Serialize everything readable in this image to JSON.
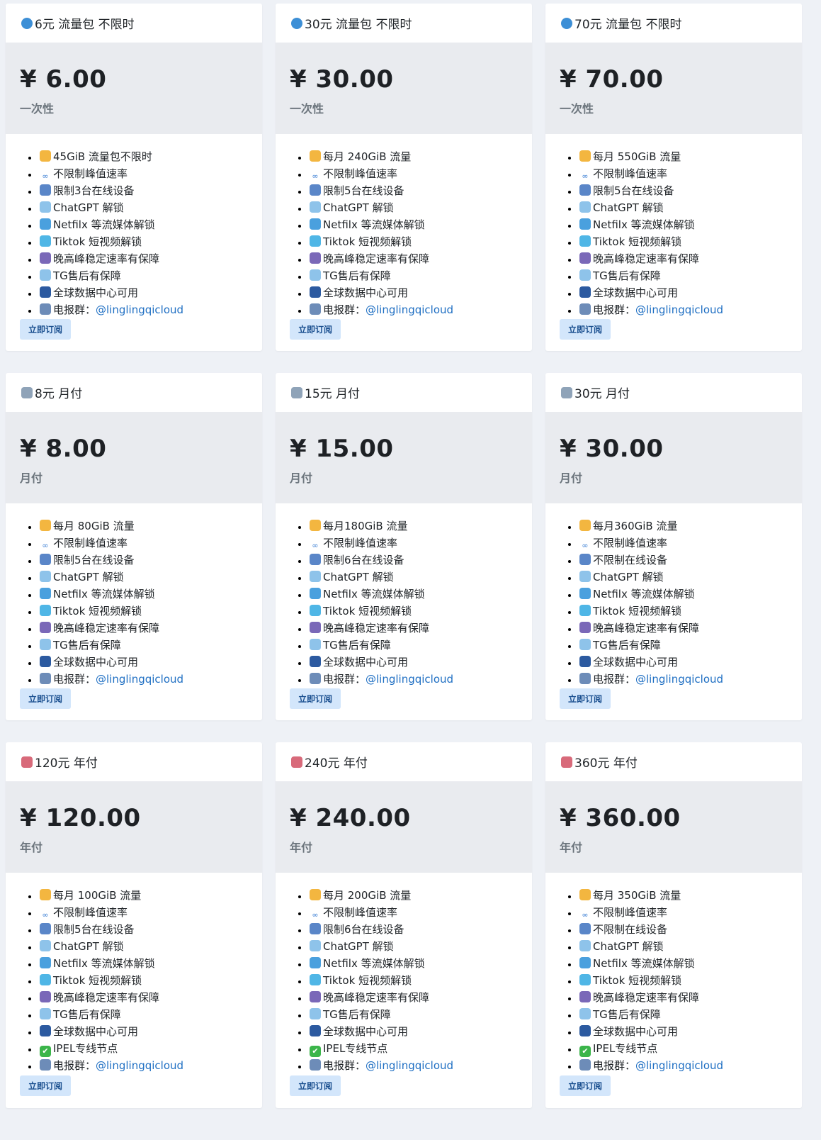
{
  "plans": [
    {
      "icon": "globe-icon",
      "name": "6元 流量包 不限时",
      "price": "¥ 6.00",
      "period": "一次性",
      "features": [
        {
          "icon": "person-icon",
          "text": "45GiB 流量包不限时"
        },
        {
          "icon": "infinity-icon",
          "text": "不限制峰值速率"
        },
        {
          "icon": "chart-icon",
          "text": "限制3台在线设备"
        },
        {
          "icon": "robot-icon",
          "text": "ChatGPT 解锁"
        },
        {
          "icon": "fish-icon",
          "text": "Netfilx 等流媒体解锁"
        },
        {
          "icon": "dolphin-icon",
          "text": "Tiktok 短视频解锁"
        },
        {
          "icon": "planet-icon",
          "text": "晚高峰稳定速率有保障"
        },
        {
          "icon": "robot-icon",
          "text": "TG售后有保障"
        },
        {
          "icon": "satellite-icon",
          "text": "全球数据中心可用"
        },
        {
          "icon": "speech-icon",
          "text": "电报群：",
          "link": "@linglingqicloud"
        }
      ],
      "button": "立即订阅"
    },
    {
      "icon": "globe-icon",
      "name": "30元 流量包 不限时",
      "price": "¥ 30.00",
      "period": "一次性",
      "features": [
        {
          "icon": "person-icon",
          "text": "每月 240GiB 流量"
        },
        {
          "icon": "infinity-icon",
          "text": "不限制峰值速率"
        },
        {
          "icon": "chart-icon",
          "text": "限制5台在线设备"
        },
        {
          "icon": "robot-icon",
          "text": "ChatGPT 解锁"
        },
        {
          "icon": "fish-icon",
          "text": "Netfilx 等流媒体解锁"
        },
        {
          "icon": "dolphin-icon",
          "text": "Tiktok 短视频解锁"
        },
        {
          "icon": "planet-icon",
          "text": "晚高峰稳定速率有保障"
        },
        {
          "icon": "robot-icon",
          "text": "TG售后有保障"
        },
        {
          "icon": "satellite-icon",
          "text": "全球数据中心可用"
        },
        {
          "icon": "speech-icon",
          "text": "电报群：",
          "link": "@linglingqicloud"
        }
      ],
      "button": "立即订阅"
    },
    {
      "icon": "globe-icon",
      "name": "70元 流量包 不限时",
      "price": "¥ 70.00",
      "period": "一次性",
      "features": [
        {
          "icon": "person-icon",
          "text": "每月 550GiB 流量"
        },
        {
          "icon": "infinity-icon",
          "text": "不限制峰值速率"
        },
        {
          "icon": "chart-icon",
          "text": "限制5台在线设备"
        },
        {
          "icon": "robot-icon",
          "text": "ChatGPT 解锁"
        },
        {
          "icon": "fish-icon",
          "text": "Netfilx 等流媒体解锁"
        },
        {
          "icon": "dolphin-icon",
          "text": "Tiktok 短视频解锁"
        },
        {
          "icon": "planet-icon",
          "text": "晚高峰稳定速率有保障"
        },
        {
          "icon": "robot-icon",
          "text": "TG售后有保障"
        },
        {
          "icon": "satellite-icon",
          "text": "全球数据中心可用"
        },
        {
          "icon": "speech-icon",
          "text": "电报群：",
          "link": "@linglingqicloud"
        }
      ],
      "button": "立即订阅"
    },
    {
      "icon": "plane-icon",
      "name": "8元 月付",
      "price": "¥ 8.00",
      "period": "月付",
      "features": [
        {
          "icon": "person-icon",
          "text": "每月 80GiB 流量"
        },
        {
          "icon": "infinity-icon",
          "text": "不限制峰值速率"
        },
        {
          "icon": "chart-icon",
          "text": "限制5台在线设备"
        },
        {
          "icon": "robot-icon",
          "text": "ChatGPT 解锁"
        },
        {
          "icon": "fish-icon",
          "text": "Netfilx 等流媒体解锁"
        },
        {
          "icon": "dolphin-icon",
          "text": "Tiktok 短视频解锁"
        },
        {
          "icon": "planet-icon",
          "text": "晚高峰稳定速率有保障"
        },
        {
          "icon": "robot-icon",
          "text": "TG售后有保障"
        },
        {
          "icon": "satellite-icon",
          "text": "全球数据中心可用"
        },
        {
          "icon": "speech-icon",
          "text": "电报群：",
          "link": "@linglingqicloud"
        }
      ],
      "button": "立即订阅"
    },
    {
      "icon": "plane-icon",
      "name": "15元 月付",
      "price": "¥ 15.00",
      "period": "月付",
      "features": [
        {
          "icon": "person-icon",
          "text": "每月180GiB 流量"
        },
        {
          "icon": "infinity-icon",
          "text": "不限制峰值速率"
        },
        {
          "icon": "chart-icon",
          "text": "限制6台在线设备"
        },
        {
          "icon": "robot-icon",
          "text": "ChatGPT 解锁"
        },
        {
          "icon": "fish-icon",
          "text": "Netfilx 等流媒体解锁"
        },
        {
          "icon": "dolphin-icon",
          "text": "Tiktok 短视频解锁"
        },
        {
          "icon": "planet-icon",
          "text": "晚高峰稳定速率有保障"
        },
        {
          "icon": "robot-icon",
          "text": "TG售后有保障"
        },
        {
          "icon": "satellite-icon",
          "text": "全球数据中心可用"
        },
        {
          "icon": "speech-icon",
          "text": "电报群：",
          "link": "@linglingqicloud"
        }
      ],
      "button": "立即订阅"
    },
    {
      "icon": "plane-icon",
      "name": "30元 月付",
      "price": "¥ 30.00",
      "period": "月付",
      "features": [
        {
          "icon": "person-icon",
          "text": "每月360GiB 流量"
        },
        {
          "icon": "infinity-icon",
          "text": "不限制峰值速率"
        },
        {
          "icon": "chart-icon",
          "text": "不限制在线设备"
        },
        {
          "icon": "robot-icon",
          "text": "ChatGPT 解锁"
        },
        {
          "icon": "fish-icon",
          "text": "Netfilx 等流媒体解锁"
        },
        {
          "icon": "dolphin-icon",
          "text": "Tiktok 短视频解锁"
        },
        {
          "icon": "planet-icon",
          "text": "晚高峰稳定速率有保障"
        },
        {
          "icon": "robot-icon",
          "text": "TG售后有保障"
        },
        {
          "icon": "satellite-icon",
          "text": "全球数据中心可用"
        },
        {
          "icon": "speech-icon",
          "text": "电报群：",
          "link": "@linglingqicloud"
        }
      ],
      "button": "立即订阅"
    },
    {
      "icon": "rocket-icon",
      "name": "120元 年付",
      "price": "¥ 120.00",
      "period": "年付",
      "features": [
        {
          "icon": "person-icon",
          "text": "每月 100GiB 流量"
        },
        {
          "icon": "infinity-icon",
          "text": "不限制峰值速率"
        },
        {
          "icon": "chart-icon",
          "text": "限制5台在线设备"
        },
        {
          "icon": "robot-icon",
          "text": "ChatGPT 解锁"
        },
        {
          "icon": "fish-icon",
          "text": "Netfilx 等流媒体解锁"
        },
        {
          "icon": "dolphin-icon",
          "text": "Tiktok 短视频解锁"
        },
        {
          "icon": "planet-icon",
          "text": "晚高峰稳定速率有保障"
        },
        {
          "icon": "robot-icon",
          "text": "TG售后有保障"
        },
        {
          "icon": "satellite-icon",
          "text": "全球数据中心可用"
        },
        {
          "icon": "check-icon",
          "text": "IPEL专线节点"
        },
        {
          "icon": "speech-icon",
          "text": "电报群：",
          "link": "@linglingqicloud"
        }
      ],
      "button": "立即订阅"
    },
    {
      "icon": "rocket-icon",
      "name": "240元 年付",
      "price": "¥ 240.00",
      "period": "年付",
      "features": [
        {
          "icon": "person-icon",
          "text": "每月 200GiB 流量"
        },
        {
          "icon": "infinity-icon",
          "text": "不限制峰值速率"
        },
        {
          "icon": "chart-icon",
          "text": "限制6台在线设备"
        },
        {
          "icon": "robot-icon",
          "text": "ChatGPT 解锁"
        },
        {
          "icon": "fish-icon",
          "text": "Netfilx 等流媒体解锁"
        },
        {
          "icon": "dolphin-icon",
          "text": "Tiktok 短视频解锁"
        },
        {
          "icon": "planet-icon",
          "text": "晚高峰稳定速率有保障"
        },
        {
          "icon": "robot-icon",
          "text": "TG售后有保障"
        },
        {
          "icon": "satellite-icon",
          "text": "全球数据中心可用"
        },
        {
          "icon": "check-icon",
          "text": "IPEL专线节点"
        },
        {
          "icon": "speech-icon",
          "text": "电报群：",
          "link": "@linglingqicloud"
        }
      ],
      "button": "立即订阅"
    },
    {
      "icon": "rocket-icon",
      "name": "360元 年付",
      "price": "¥ 360.00",
      "period": "年付",
      "features": [
        {
          "icon": "person-icon",
          "text": "每月 350GiB 流量"
        },
        {
          "icon": "infinity-icon",
          "text": "不限制峰值速率"
        },
        {
          "icon": "chart-icon",
          "text": "不限制在线设备"
        },
        {
          "icon": "robot-icon",
          "text": "ChatGPT 解锁"
        },
        {
          "icon": "fish-icon",
          "text": "Netfilx 等流媒体解锁"
        },
        {
          "icon": "dolphin-icon",
          "text": "Tiktok 短视频解锁"
        },
        {
          "icon": "planet-icon",
          "text": "晚高峰稳定速率有保障"
        },
        {
          "icon": "robot-icon",
          "text": "TG售后有保障"
        },
        {
          "icon": "satellite-icon",
          "text": "全球数据中心可用"
        },
        {
          "icon": "check-icon",
          "text": "IPEL专线节点"
        },
        {
          "icon": "speech-icon",
          "text": "电报群：",
          "link": "@linglingqicloud"
        }
      ],
      "button": "立即订阅"
    }
  ],
  "colors": {
    "page_bg": "#eef1f6",
    "card_bg": "#ffffff",
    "price_band": "#e9ebef",
    "link": "#1f6fc3",
    "button_bg": "#d3e6fb",
    "button_text": "#1a4f8f"
  }
}
